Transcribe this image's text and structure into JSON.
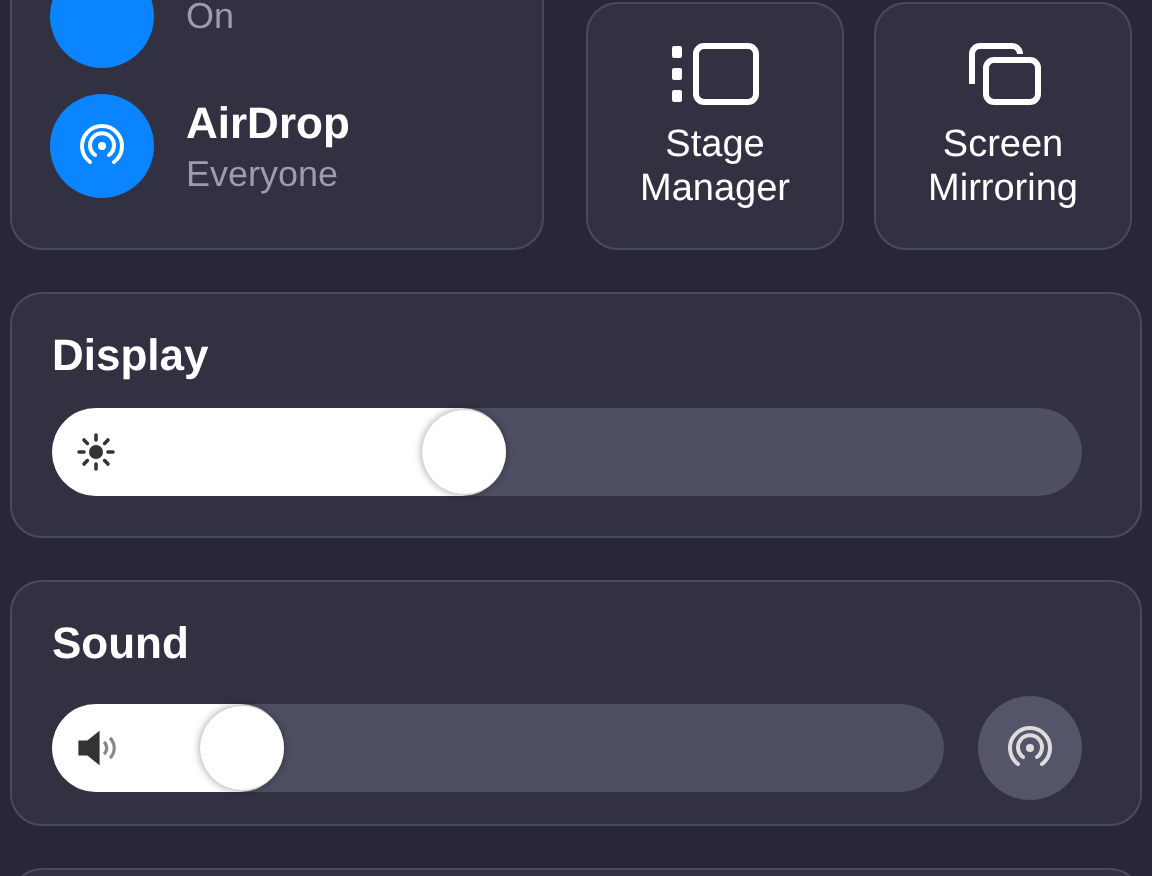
{
  "top_left": {
    "items": [
      {
        "kind": "partial",
        "subtitle": "On",
        "on": true
      },
      {
        "kind": "airdrop",
        "title": "AirDrop",
        "subtitle": "Everyone",
        "on": true
      }
    ]
  },
  "tiles": [
    {
      "kind": "stage",
      "label": "Stage Manager"
    },
    {
      "kind": "mirror",
      "label": "Screen Mirroring"
    }
  ],
  "display": {
    "title": "Display",
    "level": 0.44
  },
  "sound": {
    "title": "Sound",
    "level": 0.26
  }
}
